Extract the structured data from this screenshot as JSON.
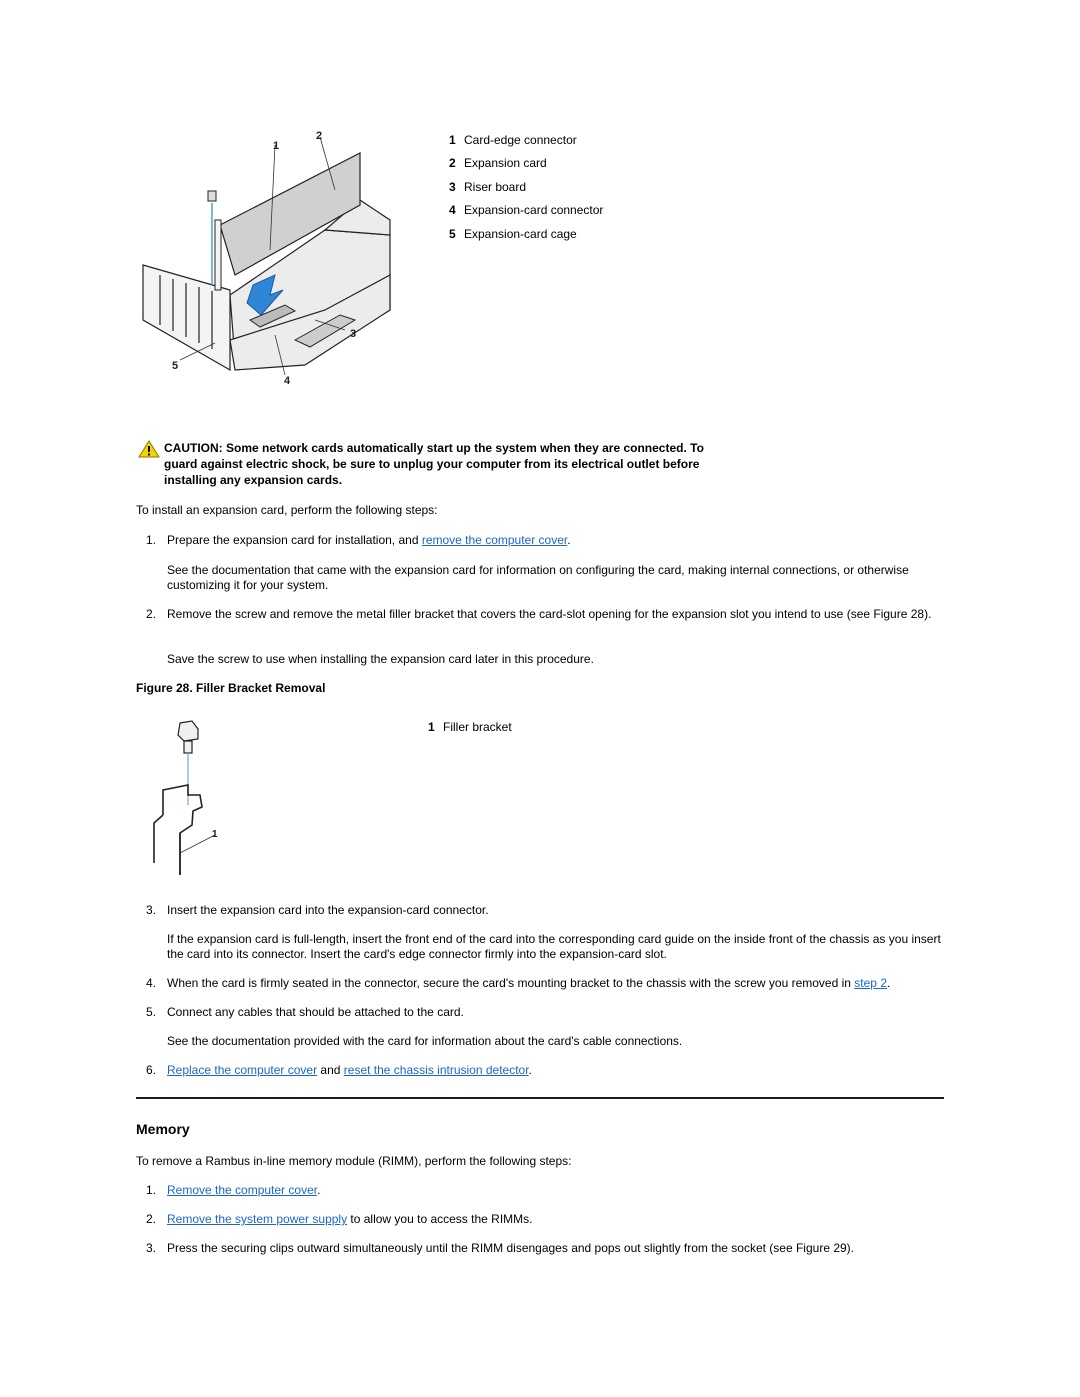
{
  "figure27": {
    "callouts": [
      "1",
      "2",
      "3",
      "4",
      "5"
    ],
    "legend": [
      {
        "num": "1",
        "label": "Card-edge connector"
      },
      {
        "num": "2",
        "label": "Expansion card"
      },
      {
        "num": "3",
        "label": "Riser board"
      },
      {
        "num": "4",
        "label": "Expansion-card connector"
      },
      {
        "num": "5",
        "label": "Expansion-card cage"
      }
    ]
  },
  "caution": {
    "icon": "warning-triangle-icon",
    "lines": [
      "CAUTION: Some network cards automatically start up the system when they are connected. To",
      "guard against electric shock, be sure to unplug your computer from its electrical outlet before",
      "installing any expansion cards."
    ]
  },
  "install": {
    "intro": "To install an expansion card, perform the following steps:",
    "step1": {
      "num": "1.",
      "text_before": "Prepare the expansion card for installation, and ",
      "link": "remove the computer cover",
      "text_after": "."
    },
    "step1_note": "See the documentation that came with the expansion card for information on configuring the card, making internal connections, or otherwise customizing it for your system.",
    "step2": {
      "num": "2.",
      "text": "Remove the screw and remove the metal filler bracket that covers the card-slot opening for the expansion slot you intend to use (see Figure 28)."
    },
    "step2_note": "Save the screw to use when installing the expansion card later in this procedure.",
    "figure28_caption": "Figure 28. Filler Bracket Removal",
    "figure28_callout": "1",
    "figure28_legend": {
      "num": "1",
      "label": "Filler bracket"
    },
    "step3": {
      "num": "3.",
      "text": "Insert the expansion card into the expansion-card connector."
    },
    "step3_note": "If the expansion card is full-length, insert the front end of the card into the corresponding card guide on the inside front of the chassis as you insert the card into its connector. Insert the card's edge connector firmly into the expansion-card slot.",
    "step4": {
      "num": "4.",
      "text_before": "When the card is firmly seated in the connector, secure the card's mounting bracket to the chassis with the screw you removed in ",
      "link": "step 2",
      "text_after": "."
    },
    "step5": {
      "num": "5.",
      "text": "Connect any cables that should be attached to the card."
    },
    "step5_note": "See the documentation provided with the card for information about the card's cable connections.",
    "step6": {
      "num": "6.",
      "link1": "Replace the computer cover",
      "middle": " and ",
      "link2": "reset the chassis intrusion detector",
      "text_after": "."
    }
  },
  "memory": {
    "heading": "Memory",
    "intro": "To remove a Rambus in-line memory module (RIMM), perform the following steps:",
    "step1": {
      "num": "1.",
      "link": "Remove the computer cover",
      "text_after": "."
    },
    "step2": {
      "num": "2.",
      "link": "Remove the system power supply",
      "text_after": " to allow you to access the RIMMs."
    },
    "step3": {
      "num": "3.",
      "text": "Press the securing clips outward simultaneously until the RIMM disengages and pops out slightly from the socket (see Figure 29)."
    }
  }
}
